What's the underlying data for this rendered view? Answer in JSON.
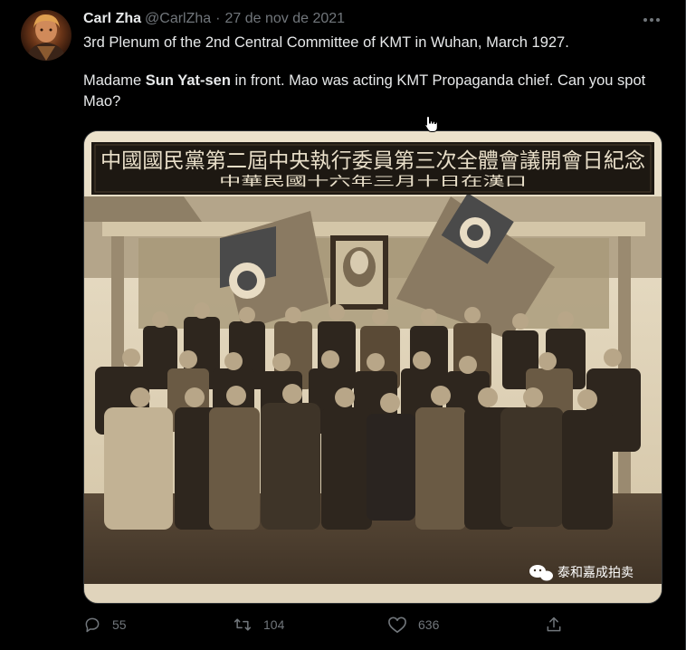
{
  "author": {
    "name": "Carl Zha",
    "handle": "@CarlZha"
  },
  "separator": "·",
  "timestamp": "27 de nov de 2021",
  "tweet": {
    "line1": "3rd Plenum of the 2nd Central Committee of KMT in Wuhan, March 1927.",
    "line2_before": "Madame ",
    "line2_bold": "Sun Yat-sen",
    "line2_after": " in front. Mao was acting KMT Propaganda chief. Can you spot Mao?"
  },
  "photo": {
    "banner_line1": "中國國民黨第二屆中央執行委員第三次全體會議開會日紀念",
    "banner_line2": "中華民國十六年三月十日在漢口",
    "watermark": "泰和嘉成拍卖"
  },
  "actions": {
    "replies": "55",
    "retweets": "104",
    "likes": "636"
  },
  "colors": {
    "background": "#000000",
    "text": "#e7e9ea",
    "muted": "#71767b",
    "border": "#2f3336"
  },
  "icons": [
    "more-icon",
    "reply-icon",
    "retweet-icon",
    "like-icon",
    "share-icon",
    "wechat-icon",
    "hand-cursor-icon"
  ]
}
